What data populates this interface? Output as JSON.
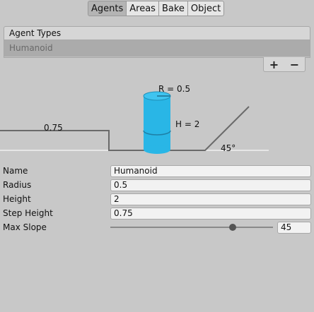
{
  "tabs": [
    "Agents",
    "Areas",
    "Bake",
    "Object"
  ],
  "agent_types": {
    "header": "Agent Types",
    "items": [
      "Humanoid"
    ],
    "add_label": "+",
    "remove_label": "−"
  },
  "diagram": {
    "radius_label": "R = 0.5",
    "height_label": "H = 2",
    "step_label": "0.75",
    "slope_label": "45°",
    "cylinder_color": "#29b6e6"
  },
  "fields": {
    "name": {
      "label": "Name",
      "value": "Humanoid"
    },
    "radius": {
      "label": "Radius",
      "value": "0.5"
    },
    "height": {
      "label": "Height",
      "value": "2"
    },
    "step_height": {
      "label": "Step Height",
      "value": "0.75"
    },
    "max_slope": {
      "label": "Max Slope",
      "value": "45",
      "fraction": 0.75
    }
  }
}
